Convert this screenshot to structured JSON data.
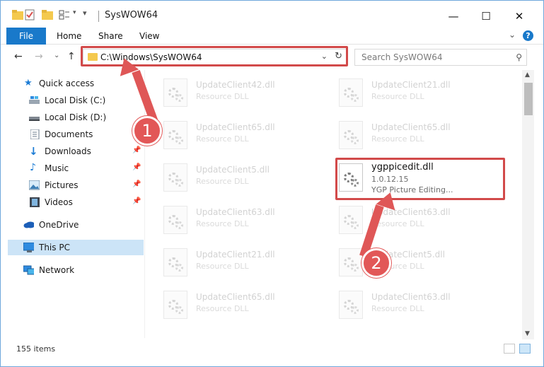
{
  "window": {
    "title": "SysWOW64"
  },
  "ribbon": {
    "tabs": [
      "File",
      "Home",
      "Share",
      "View"
    ],
    "help": "?"
  },
  "address": {
    "path": "C:\\Windows\\SysWOW64"
  },
  "search": {
    "placeholder": "Search SysWOW64"
  },
  "sidebar": {
    "items": [
      {
        "label": "Quick access"
      },
      {
        "label": "Local Disk (C:)"
      },
      {
        "label": "Local Disk (D:)"
      },
      {
        "label": "Documents"
      },
      {
        "label": "Downloads"
      },
      {
        "label": "Music"
      },
      {
        "label": "Pictures"
      },
      {
        "label": "Videos"
      },
      {
        "label": "OneDrive"
      },
      {
        "label": "This PC"
      },
      {
        "label": "Network"
      }
    ]
  },
  "files": [
    {
      "name": "UpdateClient42.dll",
      "type": "Resource DLL"
    },
    {
      "name": "UpdateClient21.dll",
      "type": "Resource DLL"
    },
    {
      "name": "UpdateClient65.dll",
      "type": "Resource DLL"
    },
    {
      "name": "UpdateClient65.dll",
      "type": "Resource DLL"
    },
    {
      "name": "UpdateClient5.dll",
      "type": "Resource DLL"
    },
    {
      "name": "ygppicedit.dll",
      "version": "1.0.12.15",
      "description": "YGP Picture Editing..."
    },
    {
      "name": "UpdateClient63.dll",
      "type": "Resource DLL"
    },
    {
      "name": "UpdateClient63.dll",
      "type": "Resource DLL"
    },
    {
      "name": "UpdateClient21.dll",
      "type": "Resource DLL"
    },
    {
      "name": "UpdateClient5.dll",
      "type": "Resource DLL"
    },
    {
      "name": "UpdateClient65.dll",
      "type": "Resource DLL"
    },
    {
      "name": "UpdateClient63.dll",
      "type": "Resource DLL"
    }
  ],
  "status": {
    "item_count": "155 items"
  },
  "callouts": {
    "step1": "1",
    "step2": "2"
  }
}
